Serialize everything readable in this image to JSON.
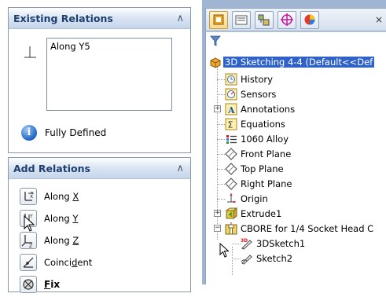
{
  "left_panel": {
    "existing_relations": {
      "title": "Existing Relations",
      "collapse_icon": "double-chevron-up",
      "items": [
        "Along Y5"
      ],
      "status_text": "Fully Defined"
    },
    "add_relations": {
      "title": "Add Relations",
      "collapse_icon": "double-chevron-up",
      "buttons": [
        {
          "pre": "Along ",
          "key": "X",
          "post": "",
          "icon": "along-x-icon"
        },
        {
          "pre": "Along ",
          "key": "Y",
          "post": "",
          "icon": "along-y-icon"
        },
        {
          "pre": "Along ",
          "key": "Z",
          "post": "",
          "icon": "along-z-icon"
        },
        {
          "pre": "Coinci",
          "key": "d",
          "post": "ent",
          "icon": "coincident-icon"
        },
        {
          "pre": "",
          "key": "F",
          "post": "ix",
          "icon": "fix-icon"
        }
      ]
    }
  },
  "right_panel": {
    "tabs": [
      "feature-manager-tab",
      "property-manager-tab",
      "configuration-manager-tab",
      "dimxpert-tab",
      "display-manager-tab"
    ],
    "tab_close": "×",
    "tree": {
      "root": "3D Sketching 4-4  (Default<<Def",
      "items": [
        {
          "label": "History",
          "icon": "history-icon"
        },
        {
          "label": "Sensors",
          "icon": "sensors-icon"
        },
        {
          "label": "Annotations",
          "icon": "annotations-icon"
        },
        {
          "label": "Equations",
          "icon": "equations-icon"
        },
        {
          "label": "1060 Alloy",
          "icon": "material-icon"
        },
        {
          "label": "Front Plane",
          "icon": "plane-icon"
        },
        {
          "label": "Top Plane",
          "icon": "plane-icon"
        },
        {
          "label": "Right Plane",
          "icon": "plane-icon"
        },
        {
          "label": "Origin",
          "icon": "origin-icon"
        },
        {
          "label": "Extrude1",
          "icon": "extrude-icon"
        },
        {
          "label": "CBORE for 1/4 Socket Head C",
          "icon": "hole-wizard-icon"
        },
        {
          "label": "3DSketch1",
          "icon": "3d-sketch-icon"
        },
        {
          "label": "Sketch2",
          "icon": "sketch-icon"
        }
      ]
    }
  },
  "colors": {
    "header_title": "#1f3f6e",
    "selection": "#2f62c9",
    "panel_bg": "#9fb5d1"
  }
}
